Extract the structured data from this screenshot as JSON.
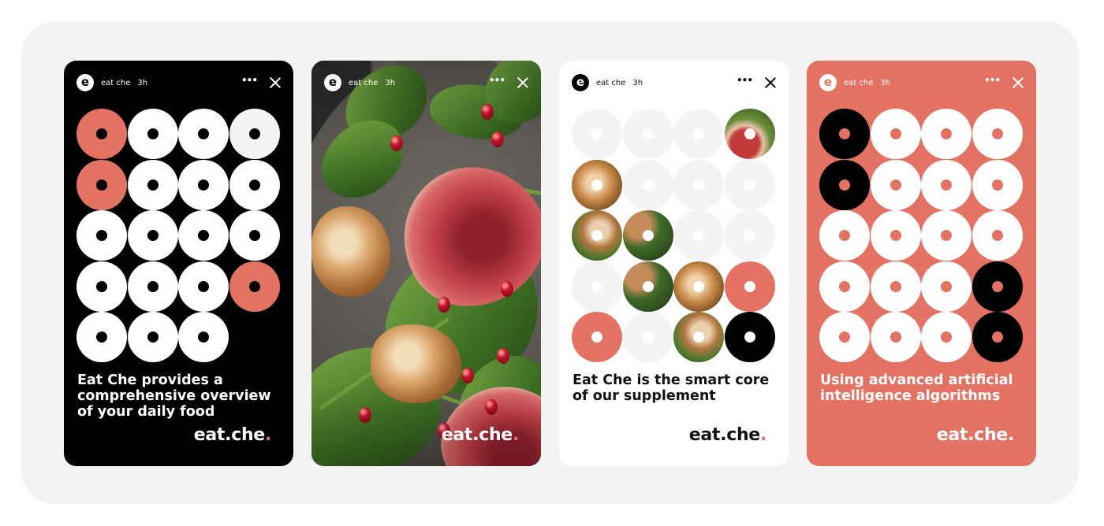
{
  "colors": {
    "coral": "#e47262",
    "black": "#000000",
    "white": "#ffffff",
    "light_gray": "#f4f4f4",
    "board_bg": "#f3f3f3"
  },
  "stories": [
    {
      "theme": "black",
      "header": {
        "avatar_letter": "e",
        "username": "eat che",
        "time": "3h",
        "more_icon": "ellipsis-icon",
        "close_icon": "close-icon"
      },
      "grid": [
        [
          "coral",
          "white",
          "white",
          "light"
        ],
        [
          "coral",
          "white",
          "white",
          "white"
        ],
        [
          "white",
          "white",
          "white",
          "white"
        ],
        [
          "white",
          "white",
          "white",
          "coral"
        ],
        [
          "white",
          "white",
          "white",
          "none"
        ]
      ],
      "caption": "Eat Che provides a comprehensive overview of your daily food",
      "logo": {
        "text": "eat.che",
        "dot": "."
      }
    },
    {
      "theme": "photo",
      "photo_subject": "salad with fig, walnuts, arugula and pomegranate seeds",
      "header": {
        "avatar_letter": "e",
        "username": "eat che",
        "time": "3h",
        "more_icon": "ellipsis-icon",
        "close_icon": "close-icon"
      },
      "caption": "",
      "logo": {
        "text": "eat.che",
        "dot": "."
      }
    },
    {
      "theme": "white",
      "header": {
        "avatar_letter": "e",
        "username": "eat che",
        "time": "3h",
        "more_icon": "ellipsis-icon",
        "close_icon": "close-icon"
      },
      "grid": [
        [
          "light",
          "light",
          "light",
          "photo-fig"
        ],
        [
          "photo-walnut",
          "light",
          "light",
          "light"
        ],
        [
          "photo-mix",
          "photo-greens",
          "light",
          "light"
        ],
        [
          "light",
          "photo-greens",
          "photo-walnut",
          "coral"
        ],
        [
          "coral",
          "light",
          "photo-mix",
          "black"
        ]
      ],
      "caption": "Eat Che is the smart core of our supplement",
      "logo": {
        "text": "eat.che",
        "dot": "."
      }
    },
    {
      "theme": "coral",
      "header": {
        "avatar_letter": "e",
        "username": "eat che",
        "time": "3h",
        "more_icon": "ellipsis-icon",
        "close_icon": "close-icon"
      },
      "grid": [
        [
          "black",
          "white",
          "white",
          "white"
        ],
        [
          "black",
          "white",
          "white",
          "white"
        ],
        [
          "white",
          "white",
          "white",
          "white"
        ],
        [
          "white",
          "white",
          "white",
          "black"
        ],
        [
          "white",
          "white",
          "white",
          "black"
        ]
      ],
      "caption": "Using advanced artificial intelligence algorithms",
      "logo": {
        "text": "eat.che",
        "dot": "."
      }
    }
  ]
}
